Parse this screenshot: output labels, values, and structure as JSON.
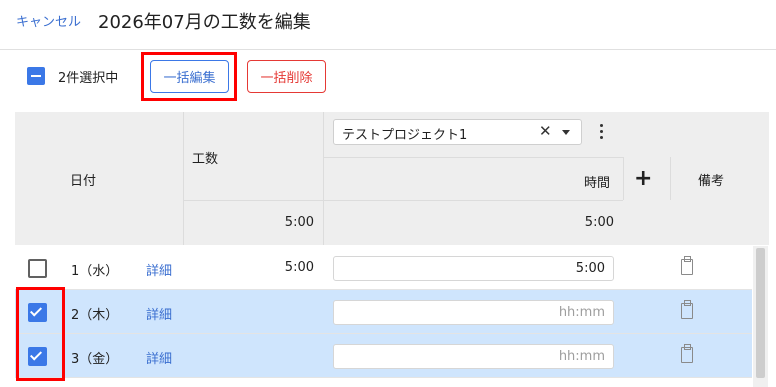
{
  "header": {
    "cancel_label": "キャンセル",
    "title": "2026年07月の工数を編集"
  },
  "toolbar": {
    "selected_count": "2件選択中",
    "bulk_edit_label": "一括編集",
    "bulk_delete_label": "一括削除"
  },
  "table": {
    "headers": {
      "date": "日付",
      "kosu": "工数",
      "hours": "時間",
      "notes": "備考"
    },
    "project": {
      "name": "テストプロジェクト1"
    },
    "totals": {
      "kosu": "5:00",
      "project": "5:00"
    },
    "rows": [
      {
        "date": "1（水）",
        "detail": "詳細",
        "kosu": "5:00",
        "value": "5:00",
        "placeholder": "hh:mm",
        "checked": false
      },
      {
        "date": "2（木）",
        "detail": "詳細",
        "kosu": "",
        "value": "",
        "placeholder": "hh:mm",
        "checked": true
      },
      {
        "date": "3（金）",
        "detail": "詳細",
        "kosu": "",
        "value": "",
        "placeholder": "hh:mm",
        "checked": true
      }
    ]
  },
  "colors": {
    "accent": "#3b78e7",
    "link": "#3b6fd0",
    "danger": "#e53935",
    "selected_row": "#cfe5fd",
    "header_bg": "#eeeeee",
    "annotation_red": "#ff0000"
  }
}
